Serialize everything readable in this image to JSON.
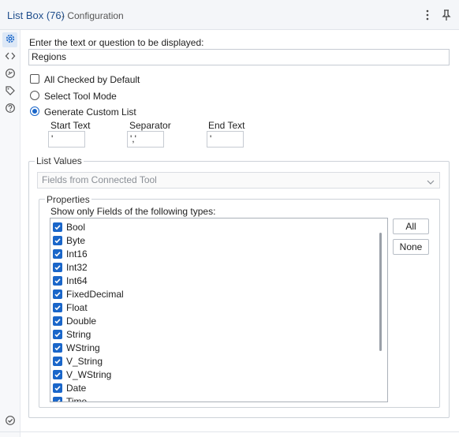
{
  "window": {
    "title": "List Box (76)",
    "subtitle": "- Configuration",
    "menu_icon": "more-vertical-icon",
    "pin_icon": "pin-icon"
  },
  "sidebar": {
    "items": [
      {
        "icon": "gear-icon",
        "active": true
      },
      {
        "icon": "code-icon",
        "active": false
      },
      {
        "icon": "connection-icon",
        "active": false
      },
      {
        "icon": "tag-icon",
        "active": false
      },
      {
        "icon": "help-icon",
        "active": false
      }
    ],
    "bottom_icon": "check-circle-icon"
  },
  "form": {
    "question_label": "Enter the text or question to be displayed:",
    "question_value": "Regions",
    "all_checked_label": "All Checked by Default",
    "all_checked": false,
    "select_tool_mode_label": "Select Tool Mode",
    "generate_custom_list_label": "Generate Custom List",
    "selected_mode": "Generate Custom List",
    "start_text_label": "Start Text",
    "start_text_value": "'",
    "separator_label": "Separator",
    "separator_value": "','",
    "end_text_label": "End Text",
    "end_text_value": "'"
  },
  "list_values": {
    "legend": "List Values",
    "dropdown_value": "Fields from Connected Tool",
    "properties": {
      "legend": "Properties",
      "description": "Show only Fields of the following types:",
      "all_button": "All",
      "none_button": "None",
      "types": [
        {
          "label": "Bool",
          "checked": true
        },
        {
          "label": "Byte",
          "checked": true
        },
        {
          "label": "Int16",
          "checked": true
        },
        {
          "label": "Int32",
          "checked": true
        },
        {
          "label": "Int64",
          "checked": true
        },
        {
          "label": "FixedDecimal",
          "checked": true
        },
        {
          "label": "Float",
          "checked": true
        },
        {
          "label": "Double",
          "checked": true
        },
        {
          "label": "String",
          "checked": true
        },
        {
          "label": "WString",
          "checked": true
        },
        {
          "label": "V_String",
          "checked": true
        },
        {
          "label": "V_WString",
          "checked": true
        },
        {
          "label": "Date",
          "checked": true
        },
        {
          "label": "Time",
          "checked": true
        }
      ]
    }
  },
  "colors": {
    "accent": "#1a66c9",
    "title": "#1f4e8c",
    "header_bg": "#f4f6f9"
  }
}
